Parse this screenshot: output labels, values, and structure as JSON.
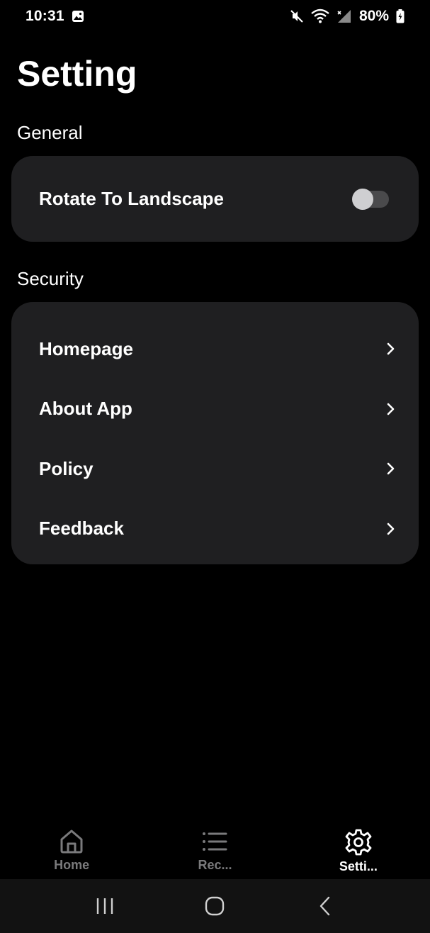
{
  "status_bar": {
    "time": "10:31",
    "battery": "80%"
  },
  "page": {
    "title": "Setting"
  },
  "sections": {
    "general": {
      "label": "General",
      "items": [
        {
          "label": "Rotate To Landscape",
          "toggle_on": false
        }
      ]
    },
    "security": {
      "label": "Security",
      "items": [
        {
          "label": "Homepage"
        },
        {
          "label": "About App"
        },
        {
          "label": "Policy"
        },
        {
          "label": "Feedback"
        }
      ]
    }
  },
  "bottom_nav": {
    "items": [
      {
        "label": "Home",
        "icon": "home-icon"
      },
      {
        "label": "Rec...",
        "icon": "list-icon"
      },
      {
        "label": "Setti...",
        "icon": "gear-icon",
        "active": true
      }
    ]
  },
  "colors": {
    "background": "#000000",
    "card": "#1f1f21",
    "inactive": "#7a7a7c",
    "active": "#ffffff"
  }
}
